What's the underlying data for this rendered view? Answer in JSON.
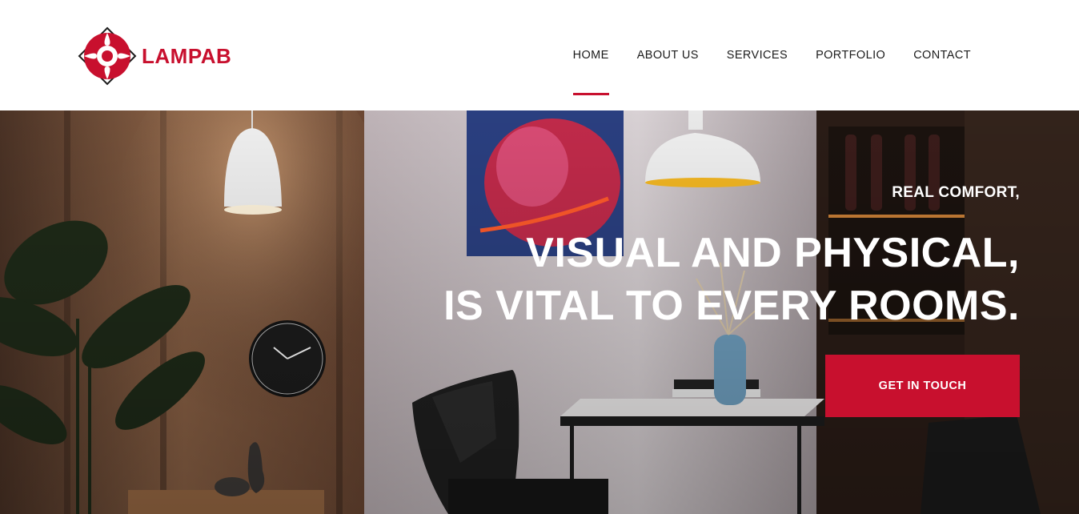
{
  "brand": {
    "name": "LAMPAB",
    "accent": "#c8102e"
  },
  "nav": {
    "items": [
      {
        "label": "HOME",
        "active": true
      },
      {
        "label": "ABOUT US",
        "active": false
      },
      {
        "label": "SERVICES",
        "active": false
      },
      {
        "label": "PORTFOLIO",
        "active": false
      },
      {
        "label": "CONTACT",
        "active": false
      }
    ]
  },
  "hero": {
    "subtitle": "REAL COMFORT,",
    "title_line1": "VISUAL AND PHYSICAL,",
    "title_line2": "IS VITAL TO EVERY ROOMS.",
    "cta_label": "GET IN TOUCH",
    "background": "interior-dining-room-photo"
  }
}
